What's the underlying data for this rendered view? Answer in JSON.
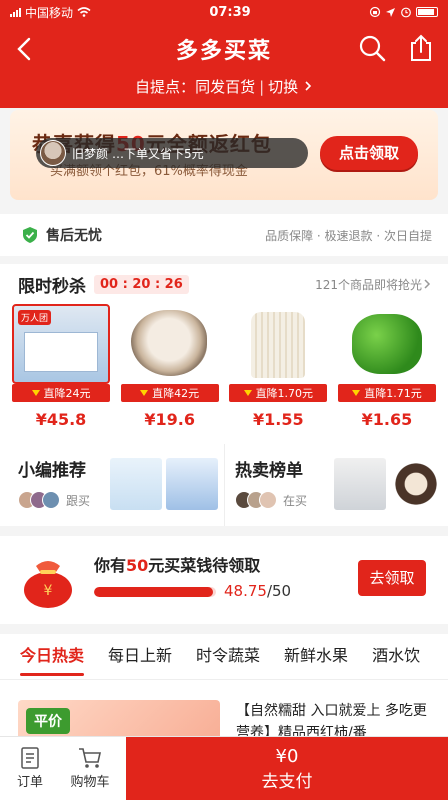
{
  "status_bar": {
    "carrier": "中国移动",
    "time": "07:39",
    "colors": {
      "text": "#ffffff"
    }
  },
  "header": {
    "title": "多多买菜",
    "pickup_label": "自提点：",
    "pickup_store": "同发百货",
    "switch_label": "切换"
  },
  "banner": {
    "headline_pre": "恭喜获得",
    "headline_amount": "50",
    "headline_post": "元全额返红包",
    "subline": "买满额领个红包，61%概率得现金",
    "cta": "点击领取",
    "marquee": {
      "user": "旧梦颜",
      "message": "…下单又省下5元"
    }
  },
  "guarantee": {
    "label": "售后无忧",
    "tags": "品质保障 · 极速退款 · 次日自提"
  },
  "flash_sale": {
    "title": "限时秒杀",
    "countdown": "00 : 20 : 26",
    "more": "121个商品即将抢光",
    "items": [
      {
        "name": "milk-box",
        "badge": "万人团",
        "drop": "直降24元",
        "price": "¥45.8"
      },
      {
        "name": "oyster",
        "drop": "直降42元",
        "price": "¥19.6"
      },
      {
        "name": "enoki-mushroom",
        "drop": "直降1.70元",
        "price": "¥1.55"
      },
      {
        "name": "green-pepper",
        "drop": "直降1.71元",
        "price": "¥1.65"
      }
    ]
  },
  "recommend": [
    {
      "title": "小编推荐",
      "caption": "跟买"
    },
    {
      "title": "热卖榜单",
      "caption": "在买"
    }
  ],
  "coupon": {
    "text_pre": "你有",
    "amount": "50",
    "text_post": "元买菜钱待领取",
    "current": "48.75",
    "total": "/50",
    "progress": 0.975,
    "button": "去领取"
  },
  "tabs": [
    "今日热卖",
    "每日上新",
    "时令蔬菜",
    "新鲜水果",
    "酒水饮"
  ],
  "feed": {
    "badge": "平价",
    "description": "【自然糯甜 入口就爱上 多吃更营养】精品西红柿/番"
  },
  "bottom": {
    "orders": "订单",
    "cart": "购物车",
    "total": "¥0",
    "pay": "去支付"
  },
  "colors": {
    "brand": "#e1251b"
  }
}
